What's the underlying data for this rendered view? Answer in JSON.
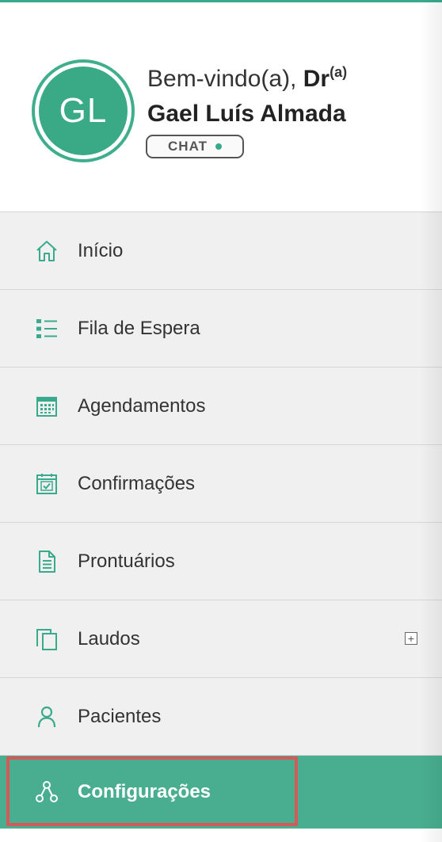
{
  "profile": {
    "avatar_initials": "GL",
    "welcome_text": "Bem-vindo(a),",
    "title": "Dr",
    "title_suffix": "(a)",
    "doctor_name": "Gael Luís Almada",
    "chat_label": "CHAT",
    "chat_status": "online"
  },
  "menu": {
    "items": [
      {
        "label": "Início",
        "icon": "home-icon"
      },
      {
        "label": "Fila de Espera",
        "icon": "list-icon"
      },
      {
        "label": "Agendamentos",
        "icon": "calendar-icon"
      },
      {
        "label": "Confirmações",
        "icon": "calendar-check-icon"
      },
      {
        "label": "Prontuários",
        "icon": "document-icon"
      },
      {
        "label": "Laudos",
        "icon": "copy-icon",
        "expand": "+"
      },
      {
        "label": "Pacientes",
        "icon": "user-icon"
      },
      {
        "label": "Configurações",
        "icon": "network-icon",
        "active": true
      }
    ]
  },
  "colors": {
    "accent": "#3aaa8c",
    "active_bg": "#48ae8f",
    "highlight": "#d45a5a"
  }
}
